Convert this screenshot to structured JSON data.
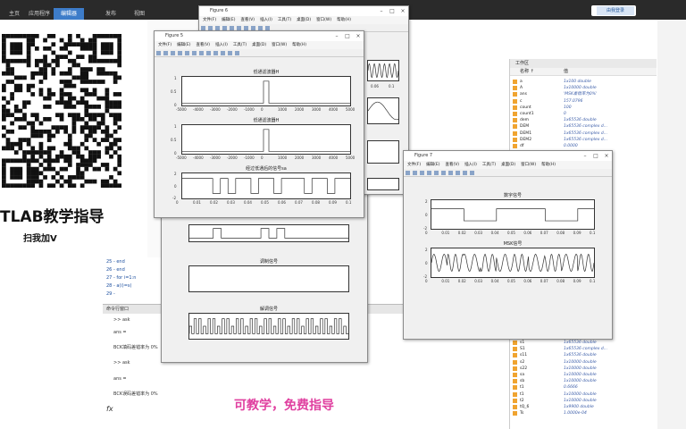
{
  "ribbon": {
    "tabs": [
      "主页",
      "应用程序",
      "编辑器",
      "发布",
      "视图"
    ]
  },
  "login": "由我登录",
  "promo": {
    "title": "TLAB教学指导",
    "subtitle": "扫我加V",
    "caption": "可教学，免费指导"
  },
  "editor": {
    "lines": [
      "25  -      end",
      "26  -   end",
      "27  -   for  i=1:n",
      "28  -         a(i)=s(",
      "29  -   "
    ]
  },
  "command": {
    "title": "命令行窗口",
    "lines": [
      ">> ask",
      "ans =",
      "BCK填码差错率为 0%",
      ">> ask",
      "ans =",
      "BCK误码差错率为 0%"
    ],
    "prompt": "fx"
  },
  "workspace": {
    "title": "工作区",
    "col_name": "名称 ↑",
    "col_value": "值",
    "rows": [
      [
        "a",
        "1x100 double"
      ],
      [
        "A",
        "1x10000 double"
      ],
      [
        "ans",
        "'MSK差错率为0%'"
      ],
      [
        "c",
        "157.0796"
      ],
      [
        "count",
        "100"
      ],
      [
        "count1",
        "0"
      ],
      [
        "dem",
        "1x65536 double"
      ],
      [
        "DEM",
        "1x65536 complex d..."
      ],
      [
        "DEM1",
        "1x65536 complex d..."
      ],
      [
        "DEM2",
        "1x65536 complex d..."
      ],
      [
        "df",
        "0.0000"
      ]
    ],
    "rows2": [
      [
        "s1",
        "1x65536 double"
      ],
      [
        "S1",
        "1x65536 complex d..."
      ],
      [
        "s11",
        "1x65536 double"
      ],
      [
        "s2",
        "1x10000 double"
      ],
      [
        "s22",
        "1x10000 double"
      ],
      [
        "sa",
        "1x10000 double"
      ],
      [
        "sb",
        "1x10000 double"
      ],
      [
        "t1",
        "0.6666"
      ],
      [
        "t1",
        "1x10000 double"
      ],
      [
        "t2",
        "1x10000 double"
      ],
      [
        "tQ_6",
        "1x9900 double"
      ],
      [
        "Ts",
        "1.0000e-04"
      ]
    ]
  },
  "fig6": {
    "title": "Figure 6",
    "menu": [
      "文件(F)",
      "编辑(E)",
      "查看(V)",
      "插入(I)",
      "工具(T)",
      "桌面(D)",
      "窗口(W)",
      "帮助(H)"
    ],
    "ticks_right": [
      "0.06",
      "0.1"
    ]
  },
  "fig5": {
    "title": "Figure 5",
    "menu": [
      "文件(F)",
      "编辑(E)",
      "查看(V)",
      "插入(I)",
      "工具(T)",
      "桌面(D)",
      "窗口(W)",
      "帮助(H)"
    ],
    "ax1_title": "低通滤波器H",
    "ax2_title": "低通滤波器H",
    "ax3_title": "经过低通后的信号sa",
    "yt1": [
      "1",
      "0.5",
      "0"
    ],
    "yt2": [
      "1",
      "0.5",
      "0"
    ],
    "yt3": [
      "2",
      "0",
      "-2"
    ],
    "xticks": [
      "-5000",
      "-4000",
      "-3000",
      "-2000",
      "-1000",
      "0",
      "1000",
      "2000",
      "3000",
      "4000",
      "5000"
    ],
    "xticks3": [
      "0",
      "0.01",
      "0.02",
      "0.03",
      "0.04",
      "0.05",
      "0.06",
      "0.07",
      "0.08",
      "0.09",
      "0.1"
    ]
  },
  "figback": {
    "ax1_title": "",
    "ax2_title": "调制信号",
    "ax3_title": "解调信号",
    "yt1": [
      "0"
    ],
    "yt2": [
      "2",
      "0",
      "-2"
    ],
    "yt3": [
      "2",
      "0",
      "-2"
    ],
    "xticks": [
      "0",
      "0.01",
      "0.02",
      "0.03",
      "0.04",
      "0.05",
      "0.06",
      "0.07",
      "0.08",
      "0.09",
      "0.1"
    ]
  },
  "fig7": {
    "title": "Figure 7",
    "menu": [
      "文件(F)",
      "编辑(E)",
      "查看(V)",
      "插入(I)",
      "工具(T)",
      "桌面(D)",
      "窗口(W)",
      "帮助(H)"
    ],
    "ax1_title": "数字信号",
    "ax2_title": "MSK信号",
    "yt1": [
      "2",
      "0",
      "-2"
    ],
    "yt2": [
      "2",
      "0",
      "-2"
    ],
    "xticks": [
      "0",
      "0.01",
      "0.02",
      "0.03",
      "0.04",
      "0.05",
      "0.06",
      "0.07",
      "0.08",
      "0.09",
      "0.1"
    ]
  },
  "fig6_right": {
    "yt": [
      "0",
      "0.06",
      "0.1"
    ]
  }
}
